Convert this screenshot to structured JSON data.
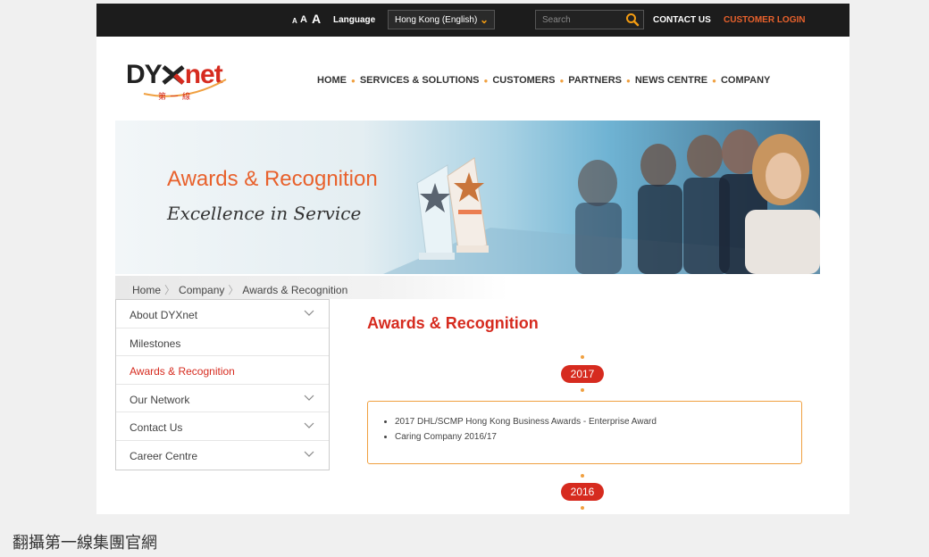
{
  "topbar": {
    "font_size_small": "A",
    "font_size_medium": "A",
    "font_size_large": "A",
    "language_label": "Language",
    "language_value": "Hong Kong (English)",
    "search_placeholder": "Search",
    "contact": "CONTACT US",
    "login": "CUSTOMER LOGIN"
  },
  "logo": {
    "word_a": "DY",
    "word_b": "net",
    "cn": "第 一 線"
  },
  "nav": {
    "home": "HOME",
    "services": "SERVICES & SOLUTIONS",
    "customers": "CUSTOMERS",
    "partners": "PARTNERS",
    "news": "NEWS CENTRE",
    "company": "COMPANY"
  },
  "banner": {
    "title": "Awards & Recognition",
    "subtitle": "Excellence in Service"
  },
  "breadcrumb": {
    "home": "Home",
    "company": "Company",
    "current": "Awards & Recognition"
  },
  "sidebar": {
    "items": [
      {
        "label": "About DYXnet",
        "has_caret": true
      },
      {
        "label": "Milestones",
        "has_caret": false
      },
      {
        "label": "Awards & Recognition",
        "has_caret": false,
        "active": true
      },
      {
        "label": "Our Network",
        "has_caret": true
      },
      {
        "label": "Contact Us",
        "has_caret": true
      },
      {
        "label": "Career Centre",
        "has_caret": true
      }
    ]
  },
  "main": {
    "title": "Awards & Recognition",
    "years": [
      {
        "year": "2017",
        "awards": [
          "2017 DHL/SCMP Hong Kong Business Awards - Enterprise Award",
          "Caring Company 2016/17"
        ]
      },
      {
        "year": "2016"
      }
    ]
  },
  "caption": "翻攝第一線集團官網",
  "colors": {
    "accent": "#d62b1f",
    "orange": "#e8612c",
    "dark_bar": "#1c1c1c"
  }
}
